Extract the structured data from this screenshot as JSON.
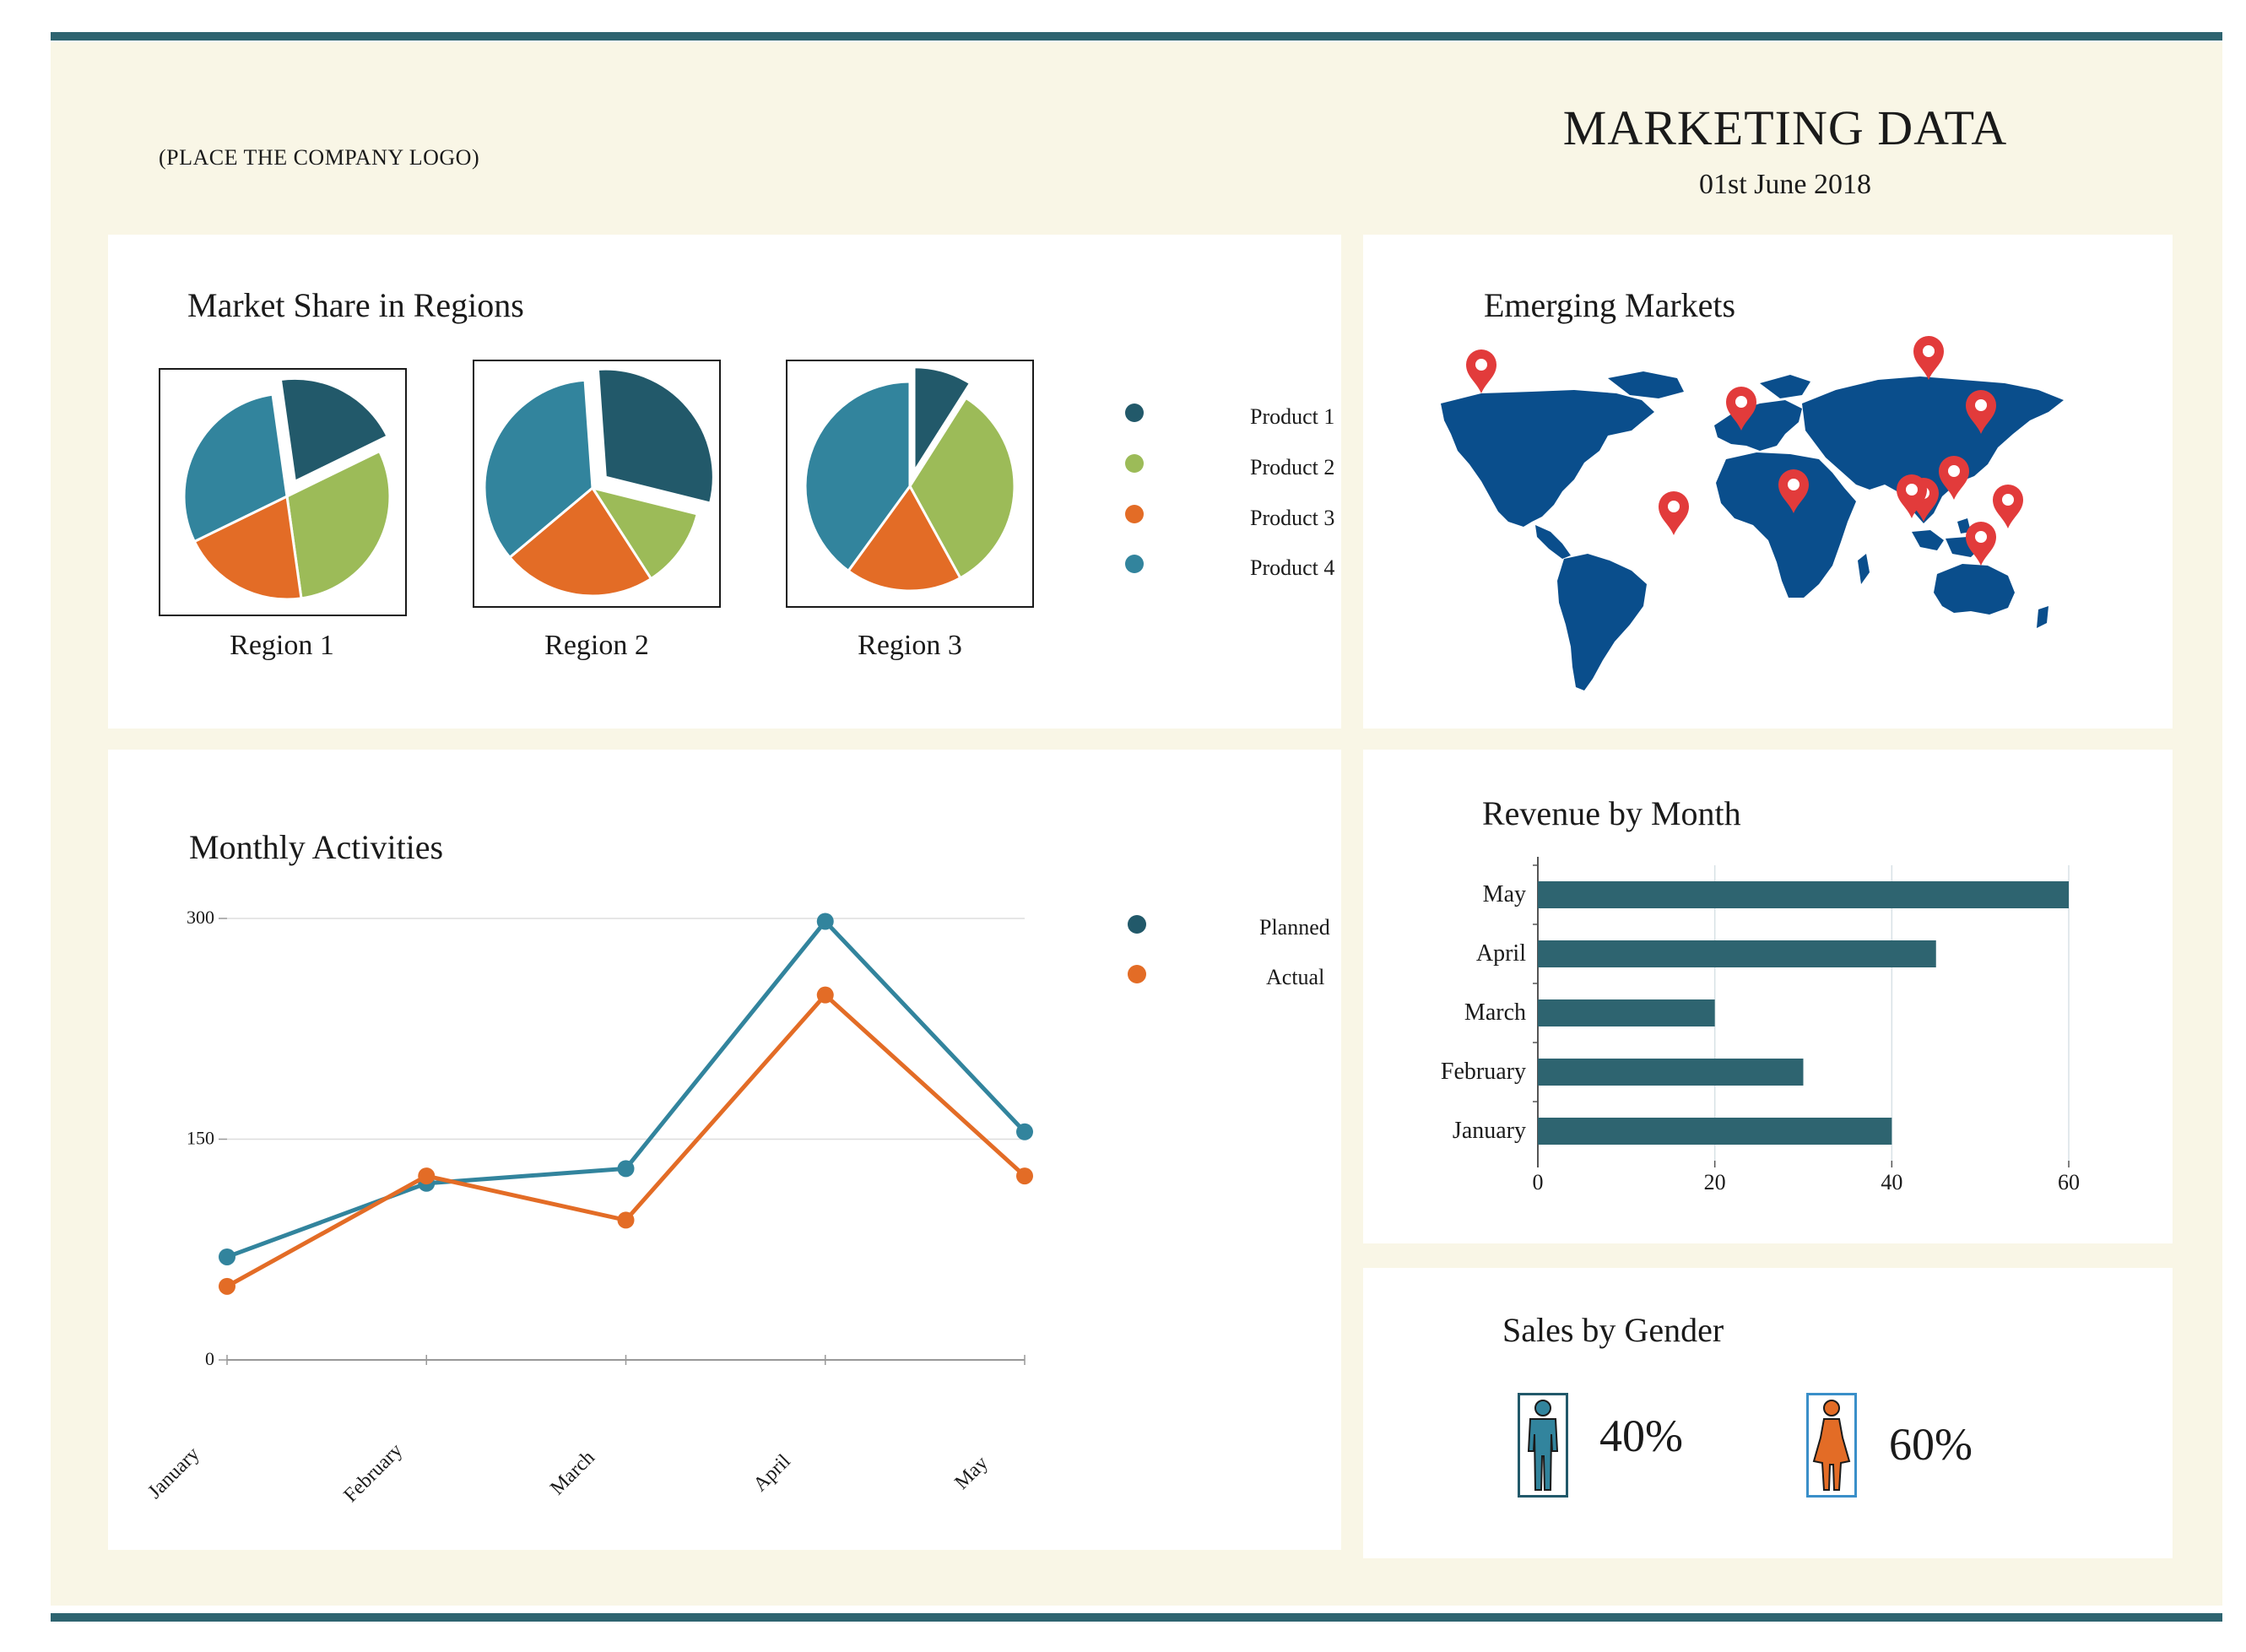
{
  "header": {
    "logo_placeholder": "(PLACE THE COMPANY LOGO)",
    "title": "MARKETING DATA",
    "date": "01st June 2018"
  },
  "colors": {
    "frame": "#2e6470",
    "background": "#f9f6e6",
    "product1": "#22596a",
    "product2": "#9cbb58",
    "product3": "#e36c26",
    "product4": "#32849d",
    "map": "#0a4e8c",
    "pin": "#e23b3b",
    "bar": "#2e6470"
  },
  "market_share": {
    "title": "Market Share in Regions",
    "legend": [
      {
        "label": "Product 1",
        "color": "#22596a"
      },
      {
        "label": "Product 2",
        "color": "#9cbb58"
      },
      {
        "label": "Product 3",
        "color": "#e36c26"
      },
      {
        "label": "Product 4",
        "color": "#32849d"
      }
    ],
    "regions": [
      {
        "name": "Region 1",
        "exploded": "Product 1",
        "values": [
          20,
          30,
          20,
          30
        ]
      },
      {
        "name": "Region 2",
        "exploded": "Product 1",
        "values": [
          30,
          12,
          23,
          35
        ]
      },
      {
        "name": "Region 3",
        "exploded": "Product 1",
        "values": [
          9,
          33,
          18,
          40
        ]
      }
    ]
  },
  "emerging_markets": {
    "title": "Emerging Markets",
    "map_icon": "world-map",
    "pin_icon": "location-pin-icon",
    "pin_count": 11
  },
  "monthly_activities": {
    "title": "Monthly Activities",
    "legend": [
      {
        "label": "Planned",
        "color": "#32849d"
      },
      {
        "label": "Actual",
        "color": "#e36c26"
      }
    ]
  },
  "revenue_by_month": {
    "title": "Revenue by Month"
  },
  "sales_by_gender": {
    "title": "Sales by Gender",
    "male_icon": "male-person-icon",
    "female_icon": "female-person-icon",
    "male_pct": "40%",
    "female_pct": "60%",
    "male_color": "#32849d",
    "female_color": "#e36c26"
  },
  "chart_data": [
    {
      "id": "monthly_activities",
      "type": "line",
      "x": [
        "January",
        "February",
        "March",
        "April",
        "May"
      ],
      "series": [
        {
          "name": "Planned",
          "values": [
            70,
            120,
            130,
            298,
            155
          ]
        },
        {
          "name": "Actual",
          "values": [
            50,
            125,
            95,
            248,
            125
          ]
        }
      ],
      "yticks": [
        0,
        150,
        300
      ],
      "ylim": [
        0,
        300
      ],
      "legend_position": "right"
    },
    {
      "id": "revenue_by_month",
      "type": "bar",
      "orientation": "horizontal",
      "categories": [
        "May",
        "April",
        "March",
        "February",
        "January"
      ],
      "values": [
        60,
        45,
        20,
        30,
        40
      ],
      "xticks": [
        0,
        20,
        40,
        60
      ],
      "xlim": [
        0,
        60
      ],
      "grid": true
    },
    {
      "id": "market_share",
      "type": "pie",
      "series": [
        {
          "name": "Region 1",
          "categories": [
            "Product 1",
            "Product 2",
            "Product 3",
            "Product 4"
          ],
          "values": [
            20,
            30,
            20,
            30
          ]
        },
        {
          "name": "Region 2",
          "categories": [
            "Product 1",
            "Product 2",
            "Product 3",
            "Product 4"
          ],
          "values": [
            30,
            12,
            23,
            35
          ]
        },
        {
          "name": "Region 3",
          "categories": [
            "Product 1",
            "Product 2",
            "Product 3",
            "Product 4"
          ],
          "values": [
            9,
            33,
            18,
            40
          ]
        }
      ]
    }
  ]
}
